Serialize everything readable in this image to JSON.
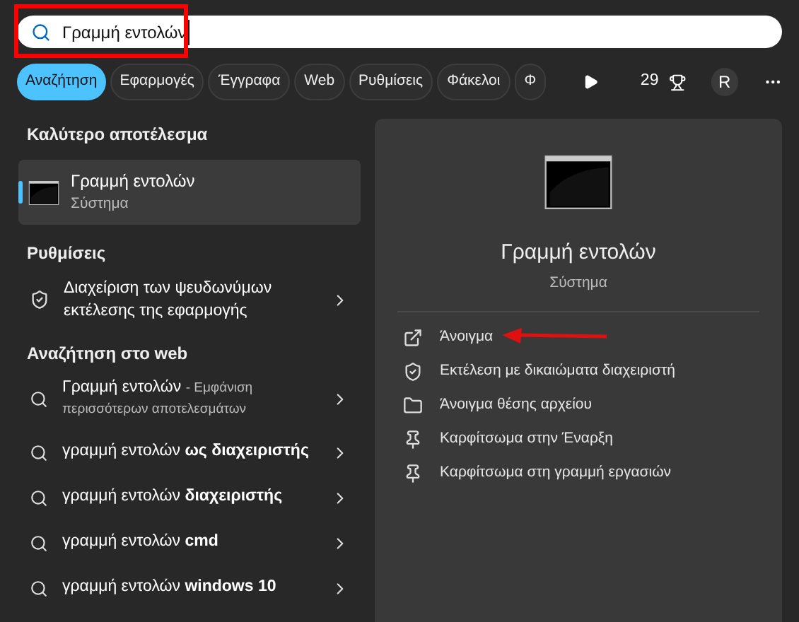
{
  "search": {
    "value": "Γραμμή εντολών"
  },
  "filters": [
    {
      "label": "Αναζήτηση",
      "selected": true
    },
    {
      "label": "Εφαρμογές",
      "selected": false
    },
    {
      "label": "Έγγραφα",
      "selected": false
    },
    {
      "label": "Web",
      "selected": false
    },
    {
      "label": "Ρυθμίσεις",
      "selected": false
    },
    {
      "label": "Φάκελοι",
      "selected": false
    },
    {
      "label": "Φ",
      "selected": false
    }
  ],
  "rewards": {
    "points": "29",
    "avatar": "R"
  },
  "best_match": {
    "heading": "Καλύτερο αποτέλεσμα",
    "title": "Γραμμή εντολών",
    "subtitle": "Σύστημα",
    "selected": true
  },
  "settings": {
    "heading": "Ρυθμίσεις",
    "items": [
      {
        "label": "Διαχείριση των ψευδωνύμων εκτέλεσης της εφαρμογής"
      }
    ]
  },
  "web": {
    "heading": "Αναζήτηση στο web",
    "items": [
      {
        "kind": "more",
        "text": "Γραμμή εντολών",
        "note": "- Εμφάνιση περισσότερων αποτελεσμάτων"
      },
      {
        "kind": "suggestion",
        "text": "γραμμή εντολών **ως διαχειριστής**"
      },
      {
        "kind": "suggestion",
        "text": "γραμμή εντολών **διαχειριστής**"
      },
      {
        "kind": "suggestion",
        "text": "γραμμή εντολών **cmd**"
      },
      {
        "kind": "suggestion",
        "text": "γραμμή εντολών **windows 10**"
      }
    ]
  },
  "preview": {
    "title": "Γραμμή εντολών",
    "subtitle": "Σύστημα",
    "actions": [
      {
        "kind": "open",
        "label": "Άνοιγμα"
      },
      {
        "kind": "admin",
        "label": "Εκτέλεση με δικαιώματα διαχειριστή"
      },
      {
        "kind": "folder",
        "label": "Άνοιγμα θέσης αρχείου"
      },
      {
        "kind": "pin",
        "label": "Καρφίτσωμα στην Έναρξη"
      },
      {
        "kind": "pin",
        "label": "Καρφίτσωμα στη γραμμή εργασιών"
      }
    ]
  }
}
